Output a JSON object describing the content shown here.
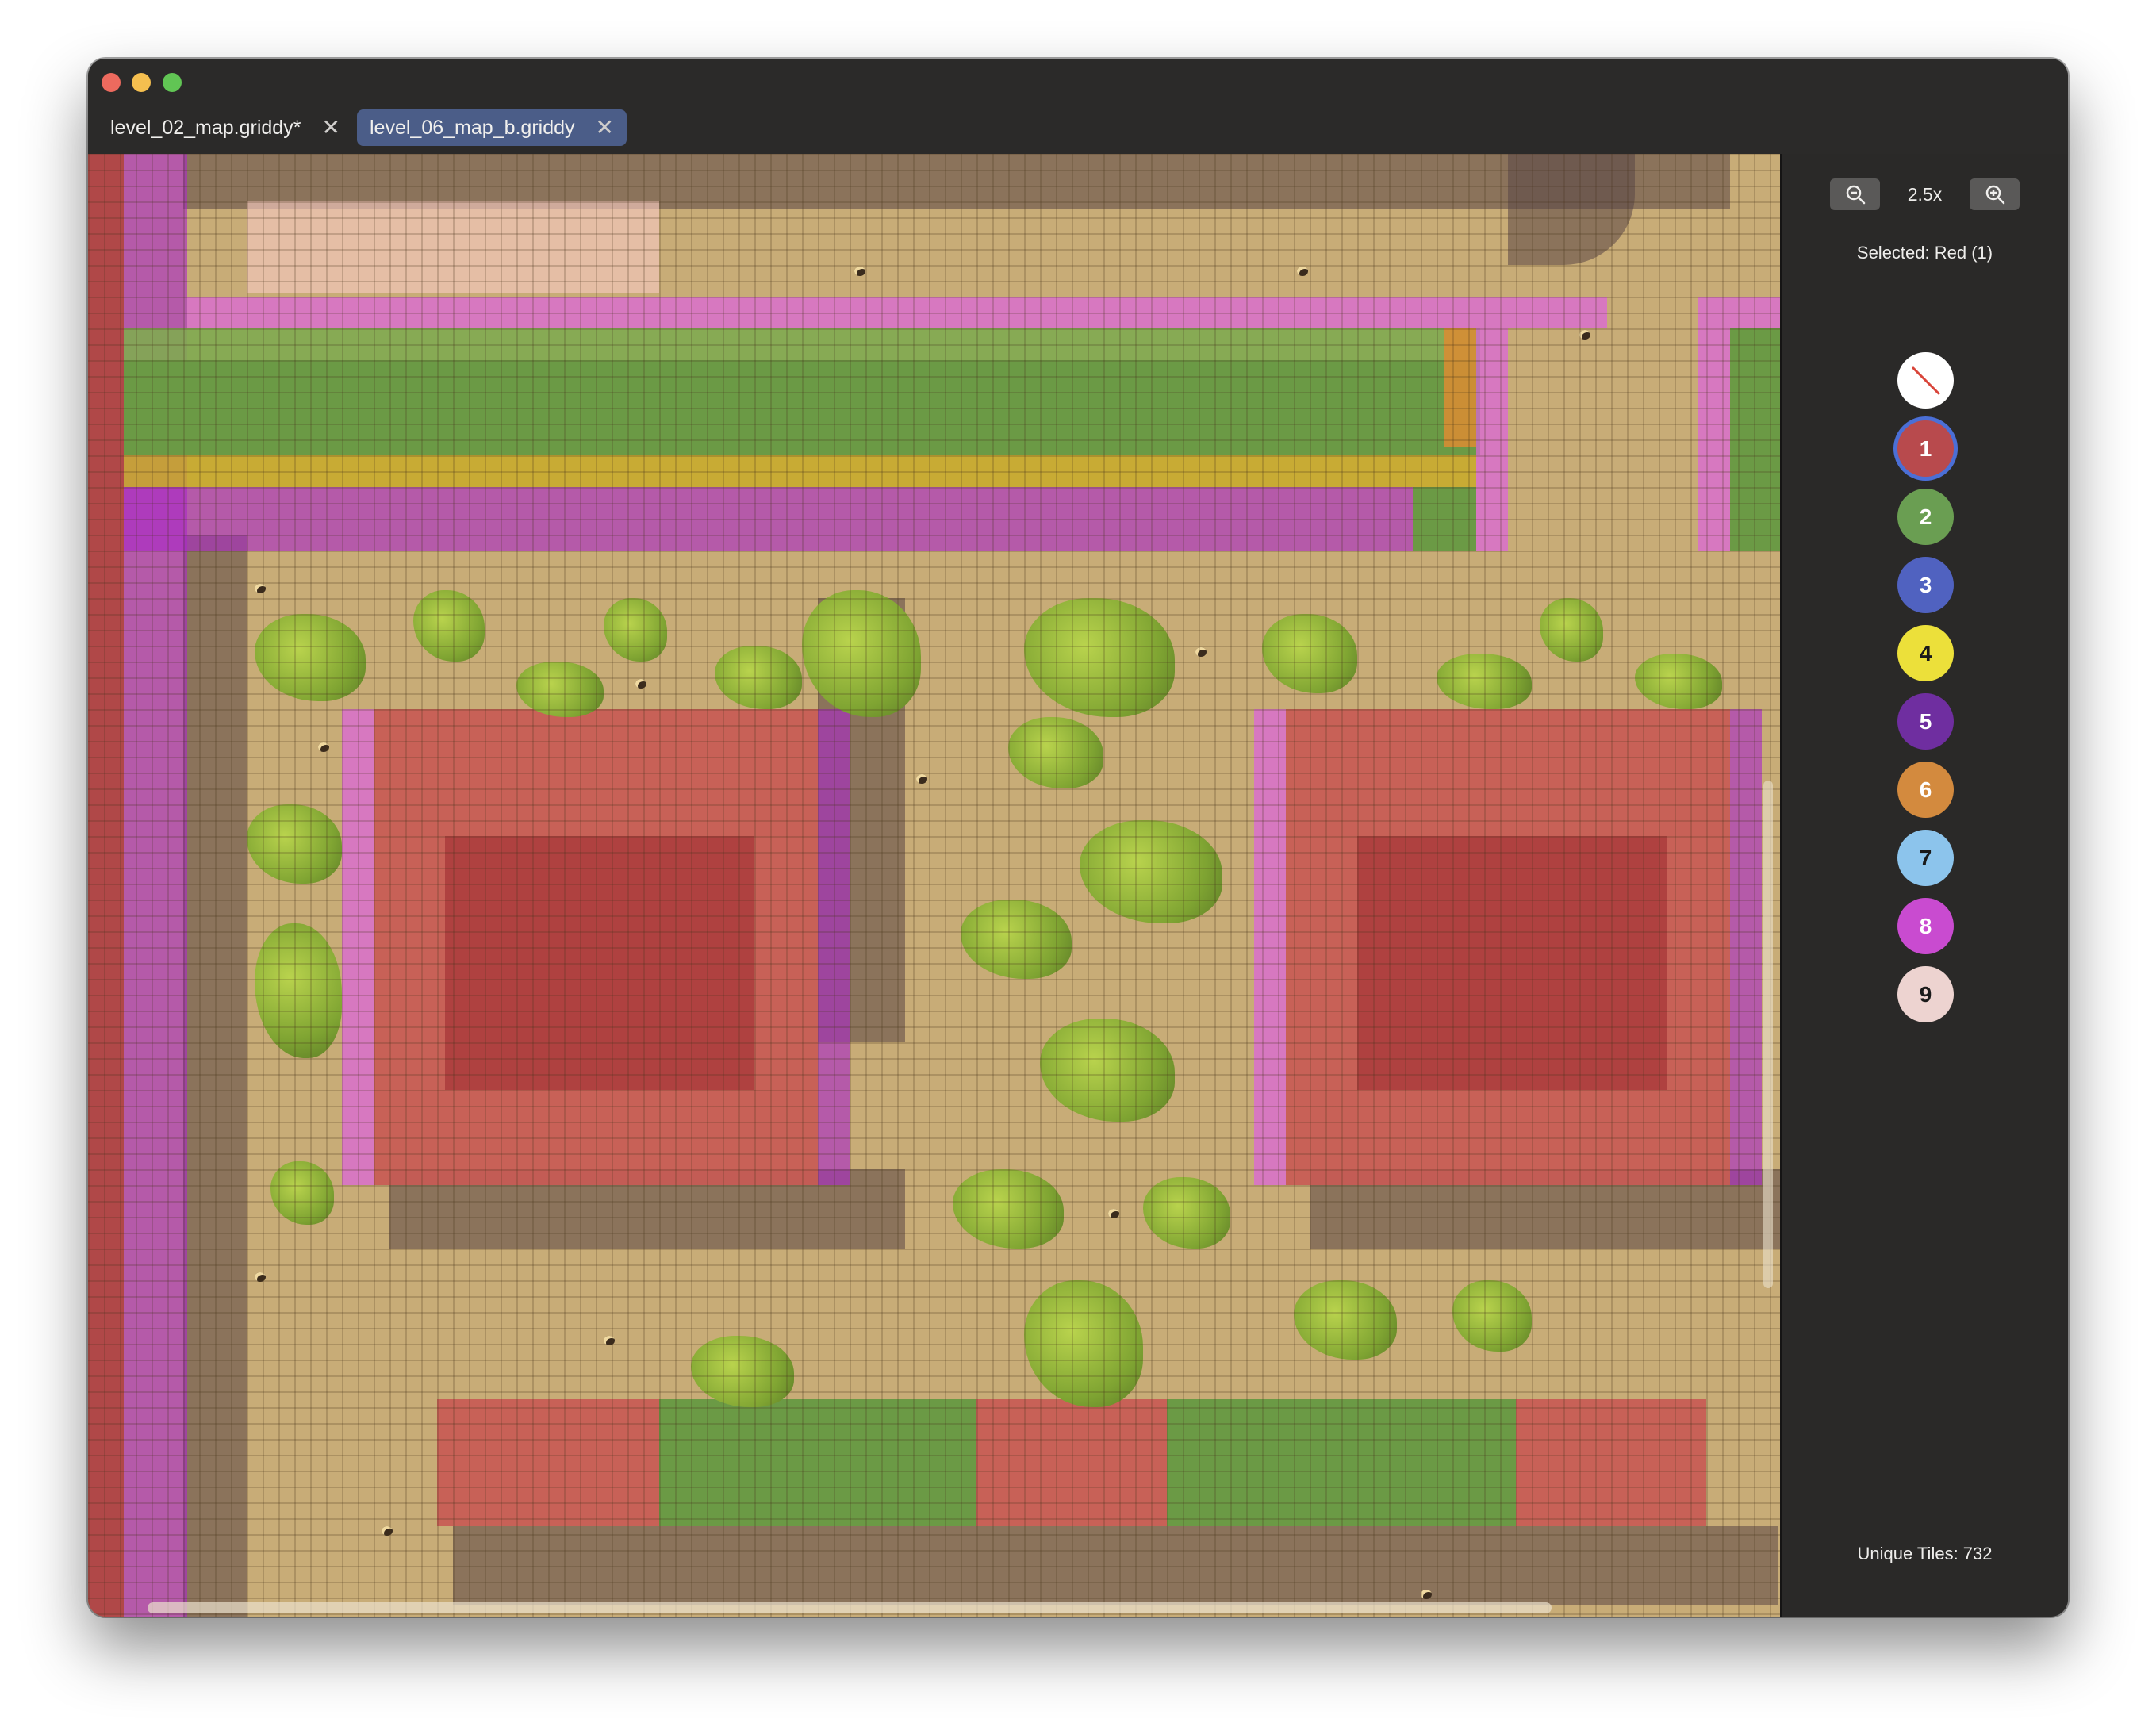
{
  "tabs": [
    {
      "label": "level_02_map.griddy*",
      "close": "✕"
    },
    {
      "label": "level_06_map_b.griddy",
      "close": "✕"
    }
  ],
  "zoom": {
    "level": "2.5x"
  },
  "selection": {
    "label": "Selected: Red (1)"
  },
  "palette": [
    {
      "label": "",
      "color": "#ffffff",
      "icon": "eraser-slash-icon"
    },
    {
      "label": "1",
      "color": "#b84a4d",
      "name": "Red"
    },
    {
      "label": "2",
      "color": "#6a9e52"
    },
    {
      "label": "3",
      "color": "#5062c0"
    },
    {
      "label": "4",
      "color": "#ece03a"
    },
    {
      "label": "5",
      "color": "#6f2ea0"
    },
    {
      "label": "6",
      "color": "#d38a3e"
    },
    {
      "label": "7",
      "color": "#8cc4ec"
    },
    {
      "label": "8",
      "color": "#c94bd0"
    },
    {
      "label": "9",
      "color": "#edd3d0"
    }
  ],
  "stats": {
    "unique_tiles": "Unique Tiles: 732"
  }
}
